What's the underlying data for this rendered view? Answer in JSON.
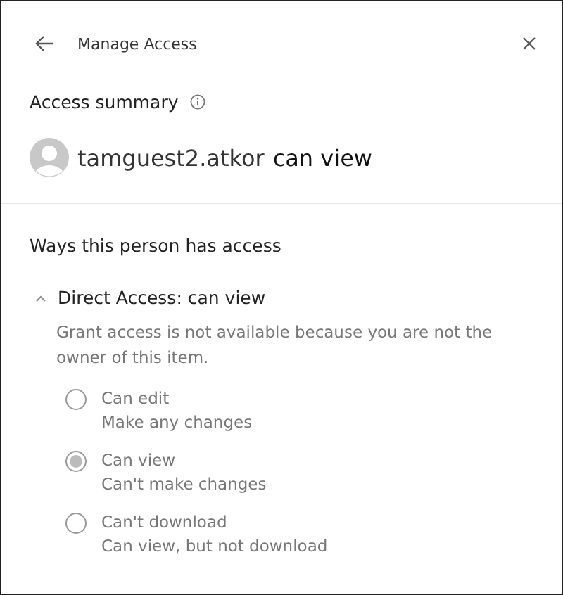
{
  "header": {
    "title": "Manage Access"
  },
  "summary": {
    "heading": "Access summary",
    "user": "tamguest2.atkor",
    "permission": "can view"
  },
  "ways": {
    "heading": "Ways this person has access",
    "section": {
      "title": "Direct Access: can view",
      "expanded": true,
      "note": "Grant access is not available because you are not the owner of this item.",
      "options": [
        {
          "label": "Can edit",
          "description": "Make any changes",
          "selected": false,
          "disabled": true
        },
        {
          "label": "Can view",
          "description": "Can't make changes",
          "selected": true,
          "disabled": true
        },
        {
          "label": "Can't download",
          "description": "Can view, but not download",
          "selected": false,
          "disabled": true
        }
      ]
    }
  }
}
